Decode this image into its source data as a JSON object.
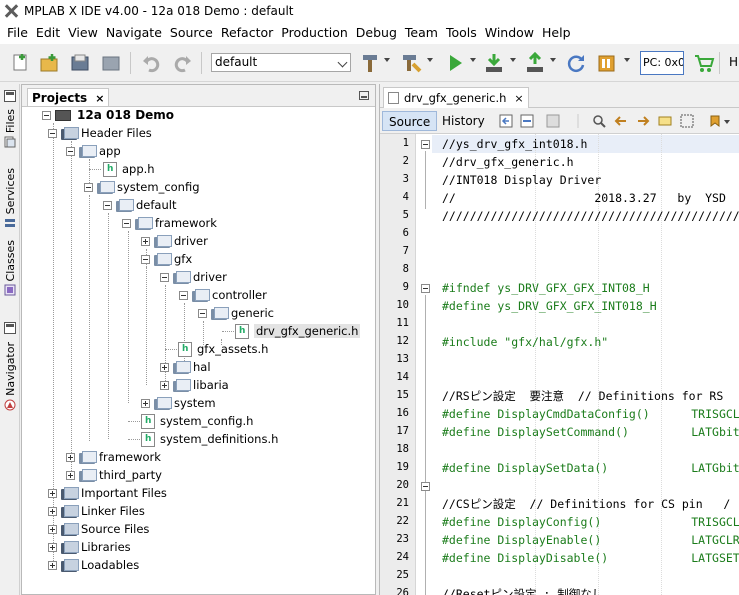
{
  "window": {
    "title": "MPLAB X IDE v4.00 - 12a 018 Demo : default"
  },
  "menu": [
    "File",
    "Edit",
    "View",
    "Navigate",
    "Source",
    "Refactor",
    "Production",
    "Debug",
    "Team",
    "Tools",
    "Window",
    "Help"
  ],
  "toolbar": {
    "configuration": "default",
    "pc_label": "PC: 0x0",
    "h_label": "H"
  },
  "sidebar_tabs": [
    "Files",
    "Services",
    "Classes",
    "Navigator"
  ],
  "projects": {
    "tab_label": "Projects",
    "close_label": "×",
    "tree": [
      {
        "label": "12a 018 Demo"
      },
      {
        "label": "Header Files"
      },
      {
        "label": "app"
      },
      {
        "label": "app.h"
      },
      {
        "label": "system_config"
      },
      {
        "label": "default"
      },
      {
        "label": "framework"
      },
      {
        "label": "driver"
      },
      {
        "label": "gfx"
      },
      {
        "label": "driver"
      },
      {
        "label": "controller"
      },
      {
        "label": "generic"
      },
      {
        "label": "drv_gfx_generic.h"
      },
      {
        "label": "gfx_assets.h"
      },
      {
        "label": "hal"
      },
      {
        "label": "libaria"
      },
      {
        "label": "system"
      },
      {
        "label": "system_config.h"
      },
      {
        "label": "system_definitions.h"
      },
      {
        "label": "framework"
      },
      {
        "label": "third_party"
      },
      {
        "label": "Important Files"
      },
      {
        "label": "Linker Files"
      },
      {
        "label": "Source Files"
      },
      {
        "label": "Libraries"
      },
      {
        "label": "Loadables"
      }
    ]
  },
  "editor": {
    "tab_label": "drv_gfx_generic.h",
    "close_label": "×",
    "source_label": "Source",
    "history_label": "History",
    "line_numbers": [
      "1",
      "2",
      "3",
      "4",
      "5",
      "6",
      "7",
      "8",
      "9",
      "10",
      "11",
      "12",
      "13",
      "14",
      "15",
      "16",
      "17",
      "18",
      "19",
      "20",
      "21",
      "22",
      "23",
      "24",
      "25",
      "26"
    ],
    "lines": [
      "//ys_drv_gfx_int018.h",
      "//drv_gfx_generic.h",
      "//INT018 Display Driver",
      "//                    2018.3.27   by  YSD",
      "///////////////////////////////////////////",
      "",
      "",
      "",
      "#ifndef ys_DRV_GFX_GFX_INT08_H",
      "#define ys_DRV_GFX_GFX_INT018_H",
      "",
      "#include \"gfx/hal/gfx.h\"",
      "",
      "",
      "//RSピン設定  要注意  // Definitions for RS",
      "#define DisplayCmdDataConfig()      TRISGCL",
      "#define DisplaySetCommand()         LATGbit",
      "",
      "#define DisplaySetData()            LATGbit",
      "",
      "//CSピン設定  // Definitions for CS pin   /",
      "#define DisplayConfig()             TRISGCL",
      "#define DisplayEnable()             LATGCLR",
      "#define DisplayDisable()            LATGSET",
      "",
      "//Resetピン設定 : 制御なし"
    ]
  }
}
